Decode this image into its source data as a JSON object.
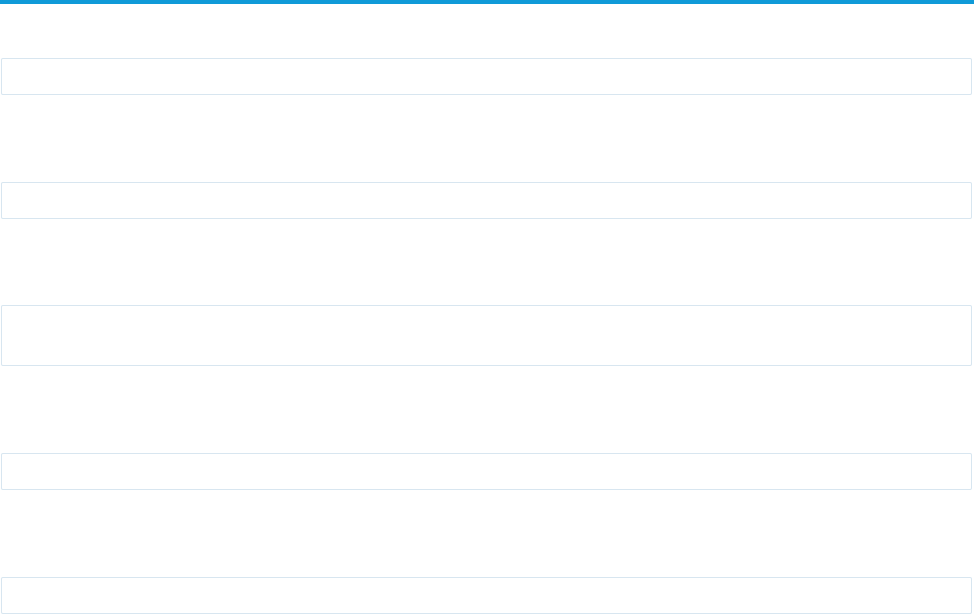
{
  "theme": {
    "accent_color": "#0f9ad8",
    "field_border_color": "#d8e6f0"
  },
  "fields": [
    {
      "value": ""
    },
    {
      "value": ""
    },
    {
      "value": ""
    },
    {
      "value": ""
    },
    {
      "value": ""
    }
  ]
}
